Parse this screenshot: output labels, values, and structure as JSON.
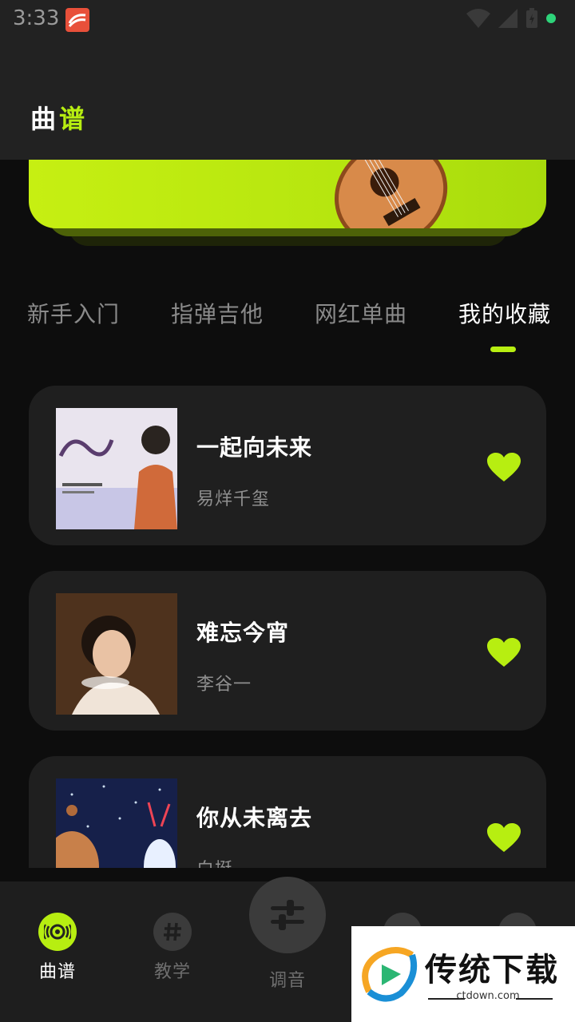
{
  "status_bar": {
    "time": "3:33",
    "colors": {
      "dot": "#2ed47a"
    }
  },
  "header": {
    "title_part1": "曲",
    "title_part2": "谱"
  },
  "tabs": [
    {
      "label": "新手入门",
      "active": false
    },
    {
      "label": "指弹吉他",
      "active": false
    },
    {
      "label": "网红单曲",
      "active": false
    },
    {
      "label": "我的收藏",
      "active": true
    }
  ],
  "songs": [
    {
      "title": "一起向未来",
      "artist": "易烊千玺",
      "favorited": true
    },
    {
      "title": "难忘今宵",
      "artist": "李谷一",
      "favorited": true
    },
    {
      "title": "你从未离去",
      "artist": "白挺",
      "favorited": true
    }
  ],
  "bottom_nav": {
    "items": [
      {
        "label": "曲谱",
        "active": true,
        "icon": "vinyl-icon"
      },
      {
        "label": "教学",
        "active": false,
        "icon": "hash-icon"
      },
      {
        "label": "调音",
        "active": false,
        "icon": "sliders-icon"
      }
    ]
  },
  "watermark": {
    "text": "传统下载",
    "url": "ctdown.com"
  },
  "colors": {
    "accent": "#b7ee11",
    "card": "#1f1f1f",
    "background": "#0d0d0d"
  }
}
